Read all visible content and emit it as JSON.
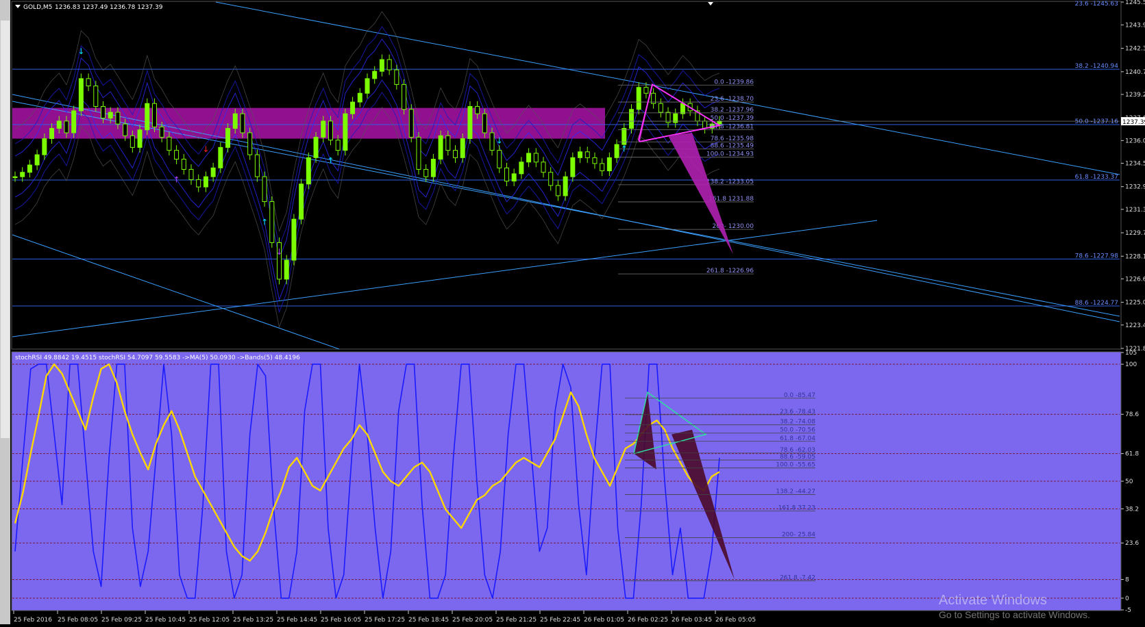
{
  "window": {
    "symbol": "GOLD,M5",
    "ohlc": "1236.83 1237.49 1236.78 1237.39"
  },
  "indicator_header": "stochRSI 49.8842 19.4515  stochRSI 54.7097 59.5583  ->MA(5) 50.0930  ->Bands(5) 48.4196",
  "watermark": {
    "line1": "Activate Windows",
    "line2": "Go to Settings to activate Windows."
  },
  "colors": {
    "price_bg": "#000000",
    "ind_bg": "#7b68ee",
    "candle": "#7cfc00",
    "hline": "#2f5fe0",
    "fib": "#8f8fef",
    "zone": "#a012a0",
    "stoch_fast": "#1a1aff",
    "stoch_slow": "#ffd700"
  },
  "chart_data": [
    {
      "type": "line",
      "title": "GOLD,M5",
      "ylim": [
        1221.87,
        1245.53
      ],
      "y_ticks": [
        "1245.53",
        "1243.97",
        "1242.37",
        "1240.77",
        "1239.22",
        "1237.62",
        "1236.07",
        "1234.52",
        "1232.92",
        "1231.37",
        "1229.77",
        "1228.17",
        "1226.62",
        "1225.02",
        "1223.47",
        "1221.87"
      ],
      "current_price": "1237.39",
      "close": [
        1233.6,
        1233.9,
        1234.4,
        1235.1,
        1236.2,
        1236.9,
        1237.4,
        1236.6,
        1238.1,
        1240.3,
        1239.8,
        1238.4,
        1237.6,
        1238.0,
        1237.2,
        1236.4,
        1235.6,
        1236.8,
        1238.6,
        1237.0,
        1236.3,
        1235.4,
        1234.8,
        1234.1,
        1233.4,
        1232.9,
        1233.6,
        1234.2,
        1235.6,
        1236.9,
        1237.9,
        1236.6,
        1235.1,
        1233.6,
        1231.9,
        1229.1,
        1226.6,
        1227.9,
        1230.7,
        1233.1,
        1234.9,
        1236.3,
        1237.4,
        1236.1,
        1235.4,
        1237.9,
        1238.7,
        1239.3,
        1240.3,
        1240.8,
        1241.6,
        1240.9,
        1239.9,
        1238.2,
        1236.3,
        1234.1,
        1233.6,
        1234.8,
        1236.4,
        1235.4,
        1234.9,
        1236.2,
        1238.4,
        1237.9,
        1236.6,
        1235.4,
        1234.2,
        1233.3,
        1233.8,
        1234.6,
        1235.2,
        1234.6,
        1233.9,
        1233.0,
        1232.3,
        1233.6,
        1234.9,
        1235.3,
        1234.9,
        1234.5,
        1234.0,
        1234.9,
        1235.8,
        1236.9,
        1238.2,
        1239.7,
        1239.3,
        1238.6,
        1238.0,
        1237.3,
        1237.9,
        1238.6,
        1238.1,
        1237.4,
        1236.9,
        1237.2,
        1237.4
      ],
      "levels_right": [
        {
          "label": "38.2 -1240.94",
          "value": 1240.94
        },
        {
          "label": "50.0 -1237.16",
          "value": 1237.16
        },
        {
          "label": "61.8 -1233.37",
          "value": 1233.37
        },
        {
          "label": "78.6 -1227.98",
          "value": 1227.98
        },
        {
          "label": "88.6 -1224.77",
          "value": 1224.77
        }
      ],
      "fib_top_label": "23.6 -1245.63",
      "fib_pattern": [
        {
          "label": "0.0 -1239.86",
          "value": 1239.86
        },
        {
          "label": "23.6 -1238.70",
          "value": 1238.7
        },
        {
          "label": "38.2 -1237.96",
          "value": 1237.96
        },
        {
          "label": "50.0 -1237.39",
          "value": 1237.39
        },
        {
          "label": "61.8 -1236.81",
          "value": 1236.81
        },
        {
          "label": "78.6 -1235.98",
          "value": 1235.98
        },
        {
          "label": "88.6 -1235.49",
          "value": 1235.49
        },
        {
          "label": "100.0 -1234.93",
          "value": 1234.93
        },
        {
          "label": "138.2  -1233.05",
          "value": 1233.05
        },
        {
          "label": "161.8 1231.88",
          "value": 1231.88
        },
        {
          "label": "200- 1230.00",
          "value": 1230.0
        },
        {
          "label": "261.8 -1226.96",
          "value": 1226.96
        }
      ],
      "zone": [
        1236.2,
        1238.3
      ]
    },
    {
      "type": "line",
      "title": "stochRSI",
      "ylim": [
        -5,
        105
      ],
      "y_ticks": [
        "105",
        "100",
        "78.6",
        "61.8",
        "50",
        "38.2",
        "23.6",
        "8",
        "0",
        "-5"
      ],
      "series": [
        {
          "name": "stochRSI",
          "values": [
            32,
            45,
            62,
            78,
            95,
            100,
            96,
            88,
            80,
            72,
            86,
            98,
            100,
            92,
            80,
            70,
            62,
            55,
            66,
            74,
            80,
            72,
            62,
            52,
            46,
            40,
            34,
            28,
            22,
            18,
            16,
            20,
            28,
            38,
            46,
            56,
            60,
            54,
            48,
            46,
            52,
            58,
            64,
            68,
            74,
            70,
            62,
            54,
            50,
            48,
            52,
            56,
            58,
            54,
            46,
            38,
            34,
            30,
            36,
            42,
            44,
            48,
            50,
            54,
            58,
            60,
            58,
            56,
            62,
            68,
            78,
            88,
            82,
            70,
            60,
            54,
            48,
            56,
            64,
            66,
            70,
            74,
            76,
            72,
            64,
            58,
            52,
            48,
            46,
            52,
            54
          ]
        },
        {
          "name": "stochRSI",
          "values": [
            20,
            60,
            98,
            100,
            100,
            70,
            40,
            100,
            100,
            60,
            20,
            5,
            60,
            100,
            100,
            30,
            5,
            20,
            60,
            100,
            70,
            10,
            0,
            0,
            40,
            100,
            100,
            20,
            0,
            10,
            70,
            100,
            95,
            40,
            0,
            0,
            20,
            80,
            100,
            100,
            30,
            0,
            10,
            60,
            100,
            70,
            30,
            0,
            20,
            80,
            100,
            100,
            40,
            0,
            0,
            10,
            60,
            100,
            100,
            50,
            10,
            0,
            20,
            70,
            100,
            100,
            60,
            20,
            30,
            80,
            100,
            90,
            40,
            10,
            60,
            100,
            100,
            30,
            0,
            0,
            40,
            100,
            100,
            50,
            10,
            30,
            0,
            0,
            0,
            20,
            60
          ]
        }
      ],
      "fib_labels": [
        "0.0 -85.47",
        "23.6 -78.43",
        "38.2 -74.08",
        "50.0 -70.56",
        "61.8 -67.04",
        "78.6 -62.03",
        "88.6 -59.05",
        "100.0 -55.65",
        "138.2  -44.27",
        "161.8 37.23",
        "200- 25.84",
        "261.8 -7.42"
      ]
    }
  ],
  "x_ticks": [
    "25 Feb 2016",
    "25 Feb 08:05",
    "25 Feb 09:25",
    "25 Feb 10:45",
    "25 Feb 12:05",
    "25 Feb 13:25",
    "25 Feb 14:45",
    "25 Feb 16:05",
    "25 Feb 17:25",
    "25 Feb 18:45",
    "25 Feb 20:05",
    "25 Feb 21:25",
    "25 Feb 22:45",
    "26 Feb 01:05",
    "26 Feb 02:25",
    "26 Feb 03:45",
    "26 Feb 05:05"
  ]
}
